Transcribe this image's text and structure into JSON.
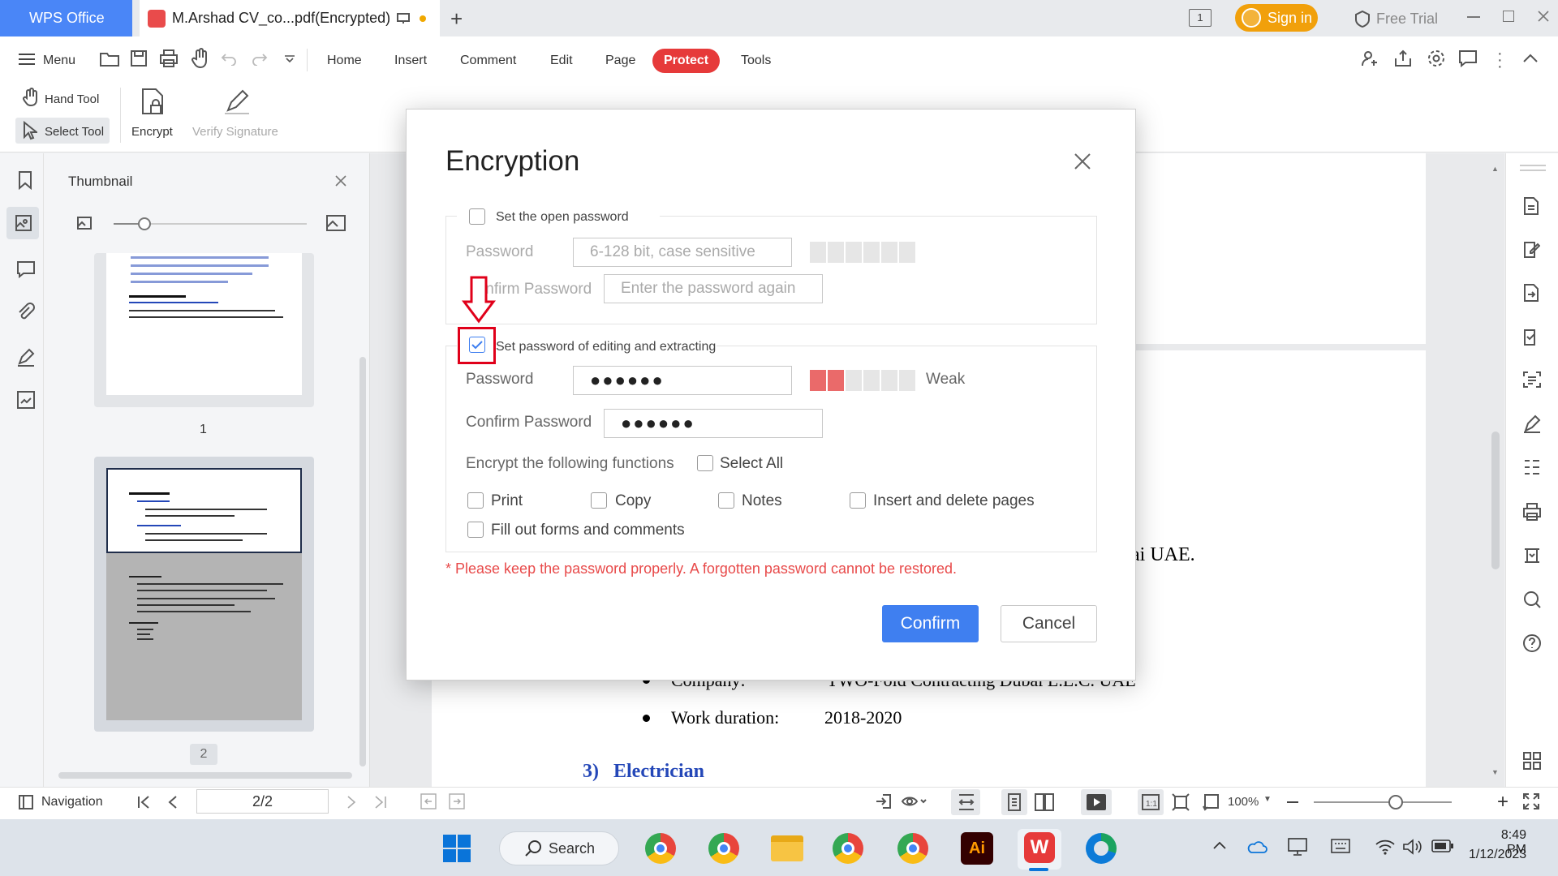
{
  "titlebar": {
    "app_tab": "WPS Office",
    "doc_tab": "M.Arshad CV_co...pdf(Encrypted)",
    "signin": "Sign in",
    "free_trial": "Free Trial",
    "page_count_badge": "1"
  },
  "menubar": {
    "menu": "Menu",
    "tabs": [
      "Home",
      "Insert",
      "Comment",
      "Edit",
      "Page",
      "Protect",
      "Tools"
    ],
    "active_tab": "Protect"
  },
  "toolbar": {
    "hand_tool": "Hand Tool",
    "select_tool": "Select Tool",
    "encrypt": "Encrypt",
    "verify_signature": "Verify Signature"
  },
  "thumbnail_panel": {
    "title": "Thumbnail",
    "page1_number": "1",
    "page2_number": "2"
  },
  "document": {
    "line1_tail": "ai UAE.",
    "company_label": "Company:",
    "company_value": "TWO-Fold Contracting Dubai L.L.C. UAE",
    "duration_label": "Work duration:",
    "duration_value": "2018-2020",
    "section_number": "3)",
    "section_title": "Electrician"
  },
  "dialog": {
    "title": "Encryption",
    "open_password_section": {
      "checkbox_label": "Set the open password",
      "checked": false,
      "password_label": "Password",
      "password_placeholder": "6-128 bit, case sensitive",
      "confirm_label": "Confirm Password",
      "confirm_placeholder": "Enter the password again"
    },
    "edit_password_section": {
      "checkbox_label": "Set password of editing and extracting",
      "checked": true,
      "password_label": "Password",
      "password_value": "●●●●●●",
      "strength_label": "Weak",
      "strength_level": 2,
      "strength_max": 6,
      "confirm_label": "Confirm Password",
      "confirm_value": "●●●●●●",
      "functions_label": "Encrypt the following functions",
      "select_all": "Select All",
      "functions": [
        "Print",
        "Copy",
        "Notes",
        "Insert and delete pages",
        "Fill out forms and comments"
      ]
    },
    "warning": "* Please keep the password properly. A forgotten password cannot be restored.",
    "confirm_button": "Confirm",
    "cancel_button": "Cancel"
  },
  "statusbar": {
    "navigation": "Navigation",
    "page_field": "2/2",
    "zoom": "100%"
  },
  "taskbar": {
    "search": "Search",
    "time": "8:49 PM",
    "date": "1/12/2023"
  },
  "colors": {
    "brand_blue": "#4a86f7",
    "protect_red": "#e63a3a",
    "highlight_red": "#e0001a",
    "confirm_blue": "#3f7ff0",
    "strength_red": "#ea6a6a",
    "warning_red": "#e84a4a",
    "signin_orange": "#f1a00b"
  }
}
